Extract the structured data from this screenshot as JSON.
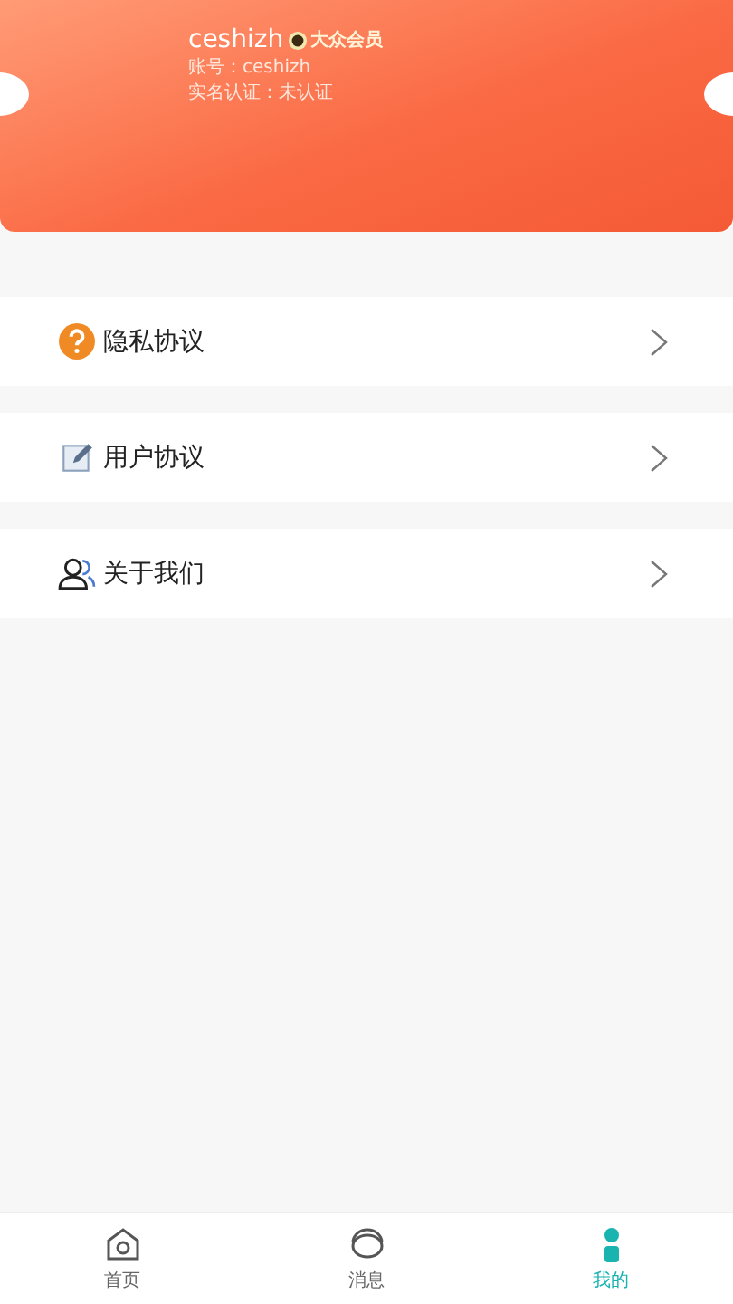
{
  "profile": {
    "username": "ceshizh",
    "badge": "大众会员",
    "account": "账号：ceshizh",
    "verification": "实名认证：未认证"
  },
  "menu": [
    {
      "kind": "question",
      "label": "隐私协议"
    },
    {
      "kind": "edit",
      "label": "用户协议"
    },
    {
      "kind": "people",
      "label": "关于我们"
    }
  ],
  "tabs": [
    {
      "kind": "home",
      "label": "首页",
      "selected": false
    },
    {
      "kind": "message",
      "label": "消息",
      "selected": false
    },
    {
      "kind": "me",
      "label": "我的",
      "selected": true
    }
  ]
}
